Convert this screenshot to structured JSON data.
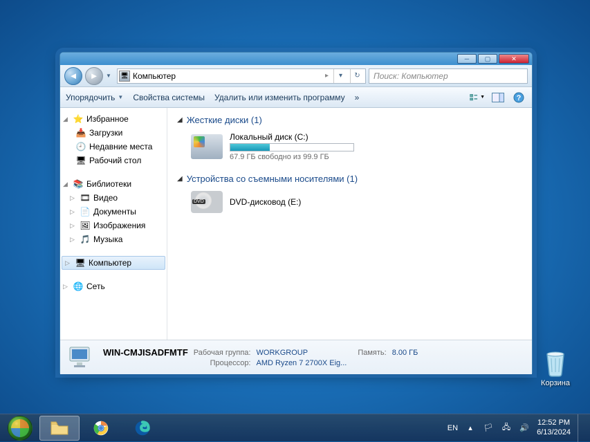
{
  "desktop": {
    "recycle": "Корзина"
  },
  "window": {
    "address": "Компьютер",
    "search_placeholder": "Поиск: Компьютер",
    "toolbar": {
      "organize": "Упорядочить",
      "properties": "Свойства системы",
      "uninstall": "Удалить или изменить программу",
      "more": "»"
    },
    "sidebar": {
      "favorites": "Избранное",
      "downloads": "Загрузки",
      "recent": "Недавние места",
      "desktop": "Рабочий стол",
      "libraries": "Библиотеки",
      "videos": "Видео",
      "documents": "Документы",
      "pictures": "Изображения",
      "music": "Музыка",
      "computer": "Компьютер",
      "network": "Сеть"
    },
    "groups": {
      "hdd": "Жесткие диски (1)",
      "removable": "Устройства со съемными носителями (1)"
    },
    "drives": {
      "c": {
        "name": "Локальный диск (C:)",
        "stats": "67.9 ГБ свободно из 99.9 ГБ",
        "fill_pct": 32
      },
      "e": {
        "name": "DVD-дисковод (E:)"
      }
    },
    "details": {
      "name": "WIN-CMJISADFMTF",
      "workgroup_lbl": "Рабочая группа:",
      "workgroup": "WORKGROUP",
      "memory_lbl": "Память:",
      "memory": "8.00 ГБ",
      "cpu_lbl": "Процессор:",
      "cpu": "AMD Ryzen 7 2700X Eig..."
    }
  },
  "taskbar": {
    "lang": "EN",
    "time": "12:52 PM",
    "date": "6/13/2024"
  }
}
